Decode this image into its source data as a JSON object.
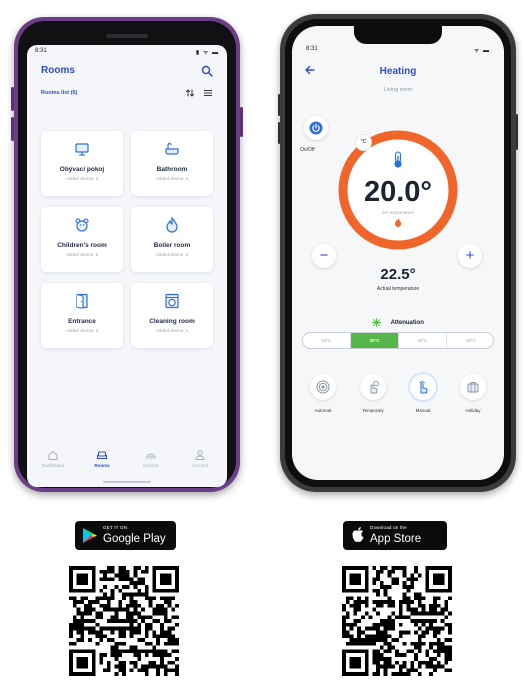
{
  "android": {
    "status_time": "8:31",
    "status_icons": "▮ ᯤ ▬",
    "title": "Rooms",
    "list_label": "Rooms list (6)",
    "rooms": [
      {
        "name": "Obývací pokoj",
        "devices": "Added device: 3",
        "icon": "tv-icon"
      },
      {
        "name": "Bathroom",
        "devices": "Added device: 4",
        "icon": "bathtub-icon"
      },
      {
        "name": "Children's room",
        "devices": "Added device: 6",
        "icon": "teddy-bear-icon"
      },
      {
        "name": "Boiler room",
        "devices": "Added device: 2",
        "icon": "flame-icon"
      },
      {
        "name": "Entrance",
        "devices": "Added device: 3",
        "icon": "door-icon"
      },
      {
        "name": "Cleaning room",
        "devices": "Added device: 1",
        "icon": "washing-machine-icon"
      }
    ],
    "nav": [
      {
        "label": "Dashboard",
        "icon": "home-icon"
      },
      {
        "label": "Rooms",
        "icon": "sofa-icon"
      },
      {
        "label": "Devices",
        "icon": "devices-icon"
      },
      {
        "label": "Account",
        "icon": "user-icon"
      }
    ],
    "active_nav": "Rooms"
  },
  "iphone": {
    "status_time": "8:31",
    "status_icons": "ᯤ ▬",
    "title": "Heating",
    "subtitle": "Living room",
    "onoff_label": "On/Off",
    "dial_badge": "℃",
    "set_temperature": "20.0°",
    "set_temperature_label": "Set temperature",
    "minus": "−",
    "plus": "+",
    "actual_temperature": "22.5°",
    "actual_temperature_label": "Actual temperature",
    "mode_name": "Attenuation",
    "presets": [
      "15°C",
      "20°C",
      "24°C",
      "28°C"
    ],
    "active_preset": "20°C",
    "modes": [
      {
        "label": "Automat",
        "icon": "auto-icon"
      },
      {
        "label": "Temporary",
        "icon": "hand-timer-icon"
      },
      {
        "label": "Manual",
        "icon": "hand-icon"
      },
      {
        "label": "Holiday",
        "icon": "suitcase-icon"
      }
    ],
    "active_mode": "Manual"
  },
  "store_badges": {
    "google_small": "GET IT ON",
    "google_big": "Google Play",
    "apple_small": "Download on the",
    "apple_big": "App Store"
  },
  "colors": {
    "accent_blue": "#2e4ec9",
    "dial_orange": "#f0652a",
    "active_green": "#55b64a",
    "android_frame": "#6b3e86"
  }
}
